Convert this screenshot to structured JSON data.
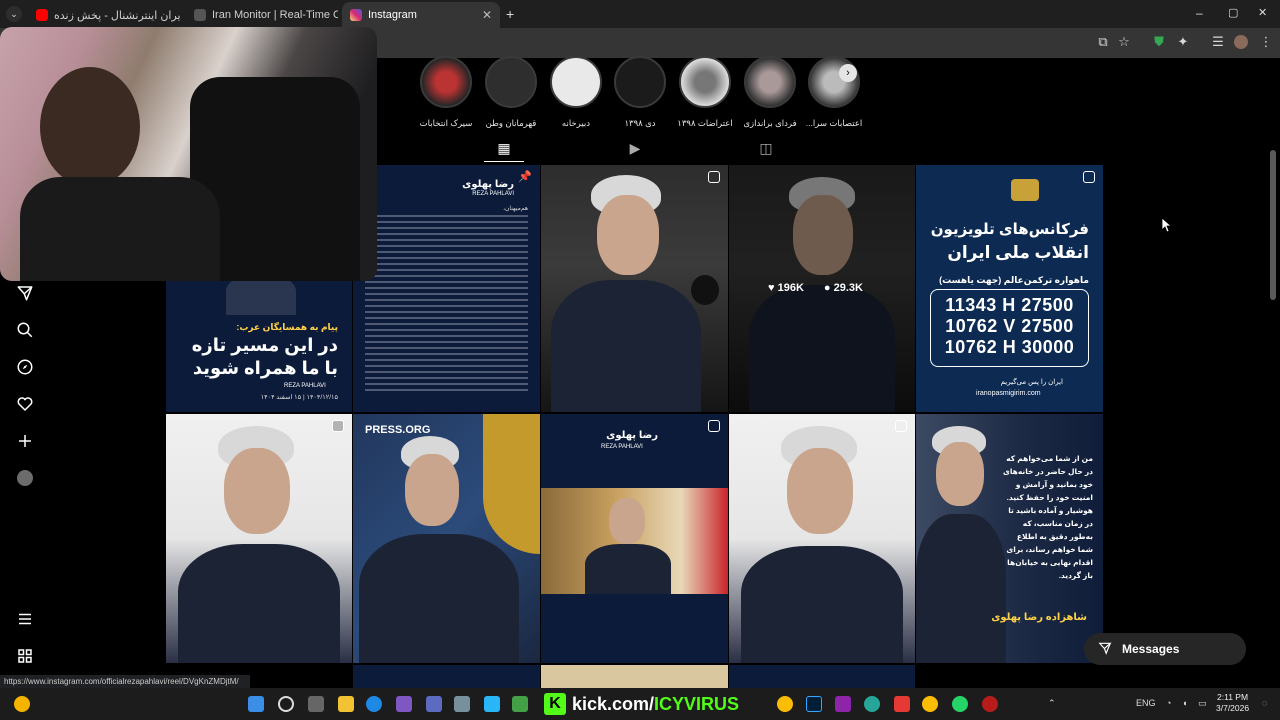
{
  "browser": {
    "tabs": [
      {
        "title": "ایران اینترنشنال - پخش زنده - ...be",
        "active": false,
        "color": "#ff0000"
      },
      {
        "title": "Iran Monitor | Real-Time OSINT",
        "active": false,
        "color": "#444444"
      },
      {
        "title": "Instagram",
        "active": true,
        "color": "#d6249f"
      }
    ],
    "new_tab": "+",
    "window_controls": {
      "minimize": "–",
      "maximize": "▢",
      "close": "✕"
    },
    "status_url": "https://www.instagram.com/officialrezapahlavi/reel/DVgKnZMDjtM/"
  },
  "highlights": [
    {
      "label": "اعتصابات سرا..."
    },
    {
      "label": "فردای براندازی"
    },
    {
      "label": "اعتراضات ۱۳۹۸"
    },
    {
      "label": "دی ۱۳۹۸"
    },
    {
      "label": "دبیرخانه"
    },
    {
      "label": "قهرمانان وطن"
    },
    {
      "label": "سیرک انتخابات"
    }
  ],
  "grid": {
    "post1": {
      "brand_fa": "رضا پهلوی",
      "brand_en": "REZA PAHLAVI",
      "greeting": "هم‌میهنان،"
    },
    "post3": {
      "likes": "196K",
      "comments": "29.3K"
    },
    "post4": {
      "title_line1": "فرکانس‌های تلویزیون",
      "title_line2": "انقلاب ملی ایران",
      "subtitle": "ماهواره ترکمن‌عالم (جهت یاهست)",
      "freq1": "11343 H 27500",
      "freq2": "10762 V 27500",
      "freq3": "10762 H 30000",
      "footer_fa": "ایران را پس می‌گیریم",
      "footer_url": "iranopasmigirim.com"
    },
    "post5": {
      "kicker": "پیام به همسایگان عرب:",
      "line1": "در این مسیر تازه",
      "line2": "با ما همراه شوید",
      "date": "۱۴۰۴/۱۲/۱۵ | ۱۵ اسفند ۱۴۰۴",
      "brand_en": "REZA PAHLAVI"
    },
    "post6": {
      "banner": "PRESS.ORG"
    },
    "post7": {
      "brand_fa": "رضا پهلوی",
      "brand_en": "REZA PAHLAVI"
    },
    "post9": {
      "quote": "من از شما می‌خواهم که در حال حاضر در خانه‌های خود بمانید و آرامش و امنیت خود را حفظ کنید. هوشیار و آماده باشید تا در زمان مناسب، که به‌طور دقیق به اطلاع شما خواهم رساند، برای اقدام نهایی به خیابان‌ها باز گردید.",
      "signature": "شاهزاده رضا پهلوی"
    }
  },
  "messages_label": "Messages",
  "stream": {
    "kick_letter": "K",
    "kick_prefix": "kick.com/",
    "kick_user": "ICYVIRUS"
  },
  "taskbar": {
    "lang": "ENG",
    "time": "2:11 PM",
    "date": "3/7/2026"
  },
  "colors": {
    "accent_green": "#53fc18",
    "ig_pink": "#d6249f",
    "navy": "#0d1b3a"
  }
}
